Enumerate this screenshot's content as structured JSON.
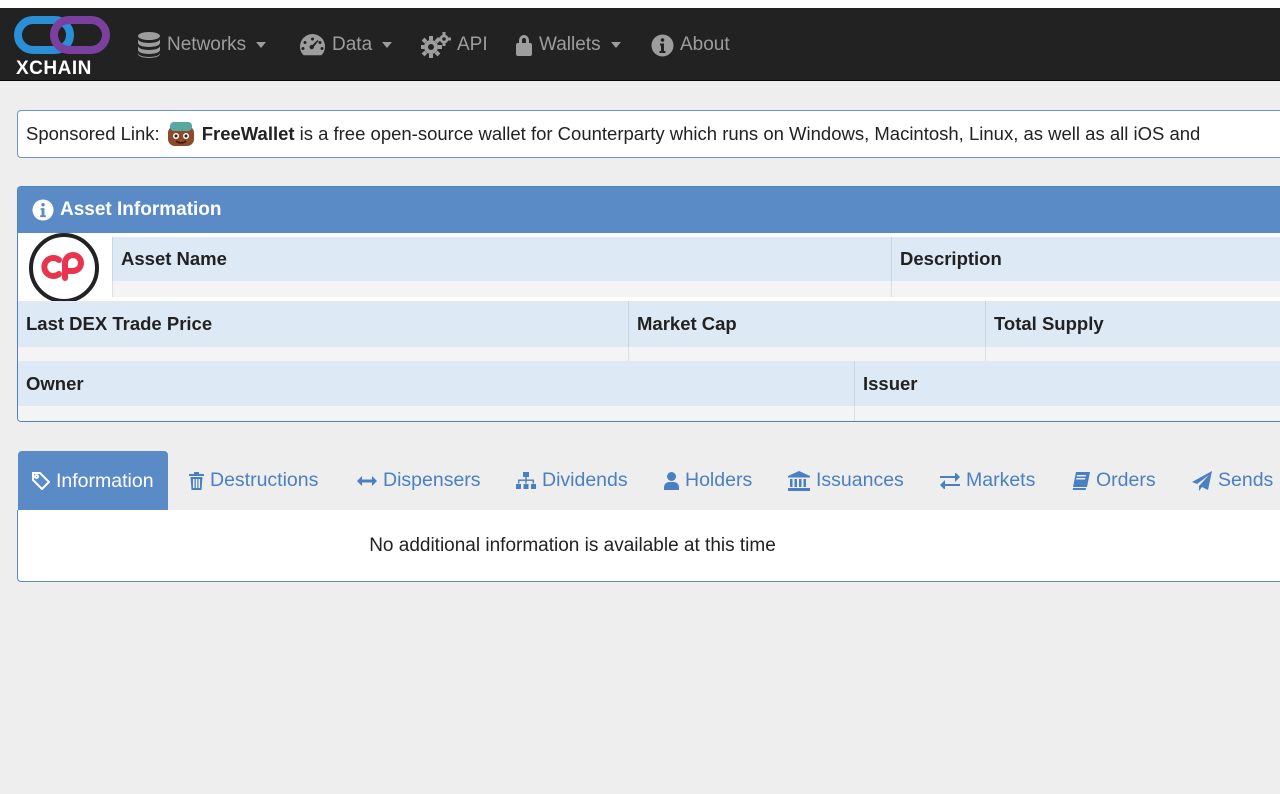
{
  "brand": {
    "name": "XCHAIN"
  },
  "nav": {
    "items": [
      {
        "label": "Networks",
        "icon": "database-icon",
        "dropdown": true
      },
      {
        "label": "Data",
        "icon": "dashboard-icon",
        "dropdown": true
      },
      {
        "label": "API",
        "icon": "gears-icon",
        "dropdown": false
      },
      {
        "label": "Wallets",
        "icon": "lock-icon",
        "dropdown": true
      },
      {
        "label": "About",
        "icon": "info-circle-icon",
        "dropdown": false
      }
    ]
  },
  "sponsor": {
    "prefix": "Sponsored Link:",
    "brand": "FreeWallet",
    "text": "is a free open-source wallet for Counterparty which runs on Windows, Macintosh, Linux, as well as all iOS and"
  },
  "asset_panel": {
    "title": "Asset Information",
    "fields": {
      "asset_name": "Asset Name",
      "description": "Description",
      "last_dex_trade_price": "Last DEX Trade Price",
      "market_cap": "Market Cap",
      "total_supply": "Total Supply",
      "owner": "Owner",
      "issuer": "Issuer"
    }
  },
  "tabs": [
    {
      "label": "Information",
      "icon": "tag-icon",
      "active": true
    },
    {
      "label": "Destructions",
      "icon": "trash-icon",
      "active": false
    },
    {
      "label": "Dispensers",
      "icon": "arrows-horizontal-icon",
      "active": false
    },
    {
      "label": "Dividends",
      "icon": "sitemap-icon",
      "active": false
    },
    {
      "label": "Holders",
      "icon": "user-icon",
      "active": false
    },
    {
      "label": "Issuances",
      "icon": "bank-icon",
      "active": false
    },
    {
      "label": "Markets",
      "icon": "exchange-icon",
      "active": false
    },
    {
      "label": "Orders",
      "icon": "book-icon",
      "active": false
    },
    {
      "label": "Sends",
      "icon": "paper-plane-icon",
      "active": false
    }
  ],
  "tab_content": {
    "message": "No additional information is available at this time"
  },
  "colors": {
    "navbar": "#222222",
    "nav_text": "#9d9d9d",
    "panel_header": "#5b8bc7",
    "cell_header": "#dde9f5",
    "link": "#4a80c2",
    "logo_blue": "#2a8fd6",
    "logo_purple": "#7b3fa0",
    "asset_red": "#e8354f"
  }
}
